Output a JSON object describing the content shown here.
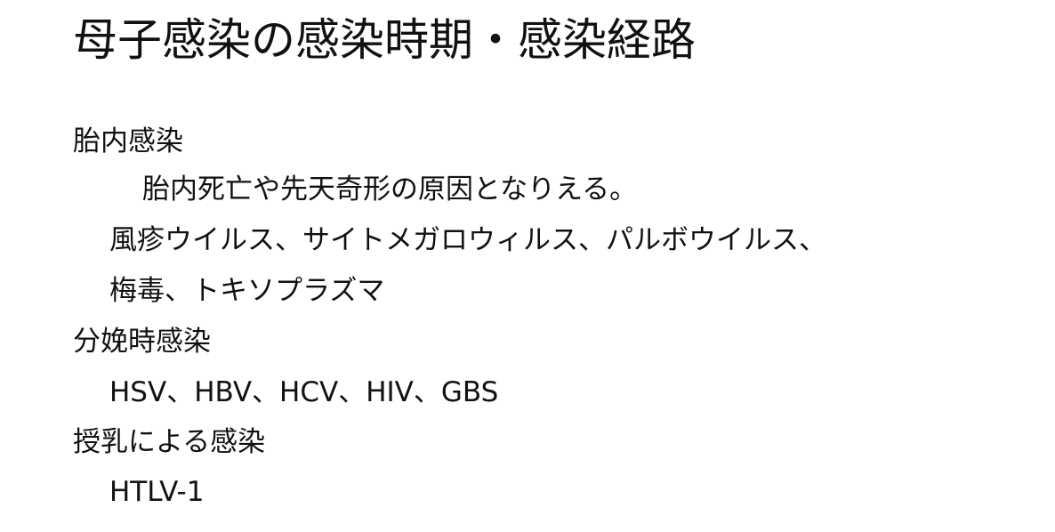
{
  "slide": {
    "title": "母子感染の感染時期・感染経路",
    "lines": [
      "胎内感染",
      "胎内死亡や先天奇形の原因となりえる。",
      "風疹ウイルス、サイトメガロウィルス、パルボウイルス、",
      "梅毒、トキソプラズマ",
      "分娩時感染",
      "HSV、HBV、HCV、HIV、GBS",
      "授乳による感染",
      "HTLV-1"
    ]
  }
}
